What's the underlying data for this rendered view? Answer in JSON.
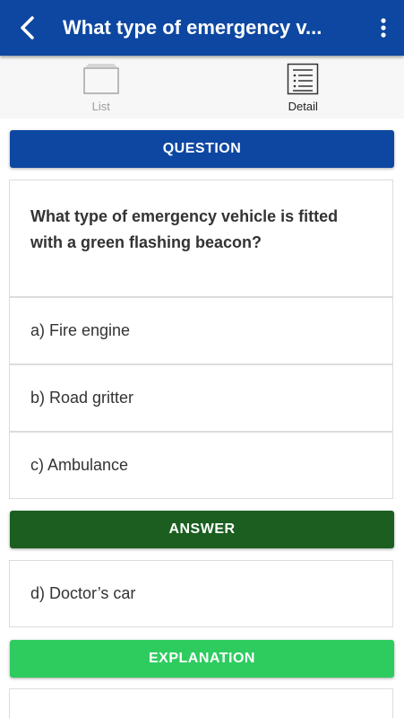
{
  "appbar": {
    "title": "What type of emergency v...",
    "back_icon": "back-arrow-icon",
    "more_icon": "more-vert-icon",
    "color": "#0d47a1"
  },
  "tabs": [
    {
      "label": "List",
      "icon": "list-cards-icon",
      "active": false
    },
    {
      "label": "Detail",
      "icon": "detail-list-icon",
      "active": true
    }
  ],
  "question": {
    "header": "QUESTION",
    "text": "What type of emergency vehicle is fitted with a green flashing beacon?",
    "options": [
      "a) Fire engine",
      "b) Road gritter",
      "c) Ambulance"
    ]
  },
  "answer": {
    "header": "ANSWER",
    "text": "d) Doctor’s car",
    "color": "#1b5e20"
  },
  "explanation": {
    "header": "EXPLANATION",
    "color": "#2ecc5f"
  }
}
